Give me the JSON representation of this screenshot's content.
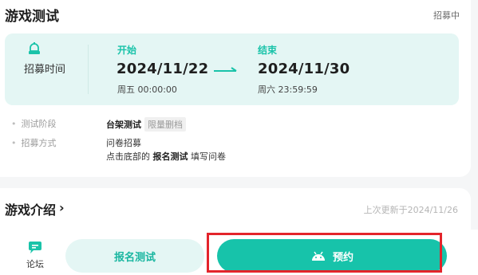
{
  "test_section": {
    "title": "游戏测试",
    "status": "招募中",
    "time_label": "招募时间",
    "start": {
      "tag": "开始",
      "date": "2024/11/22",
      "time": "周五 00:00:00"
    },
    "end": {
      "tag": "结束",
      "date": "2024/11/30",
      "time": "周六 23:59:59"
    },
    "stage": {
      "label": "测试阶段",
      "value": "台架测试",
      "tag": "限量删档"
    },
    "method": {
      "label": "招募方式",
      "line1": "问卷招募",
      "line2_prefix": "点击底部的",
      "line2_bold": "报名测试",
      "line2_suffix": "填写问卷"
    }
  },
  "intro_section": {
    "title": "游戏介绍",
    "chevron": "›",
    "updated": "上次更新于2024/11/26"
  },
  "bottom_bar": {
    "forum_label": "论坛",
    "signup_label": "报名测试",
    "reserve_label": "预约"
  },
  "colors": {
    "accent": "#17c3aa",
    "accent_light": "#e4f6f4",
    "highlight": "#e3242b"
  },
  "icons": [
    "beta-bell-icon",
    "arrow-right-icon",
    "forum-chat-icon",
    "android-icon"
  ]
}
